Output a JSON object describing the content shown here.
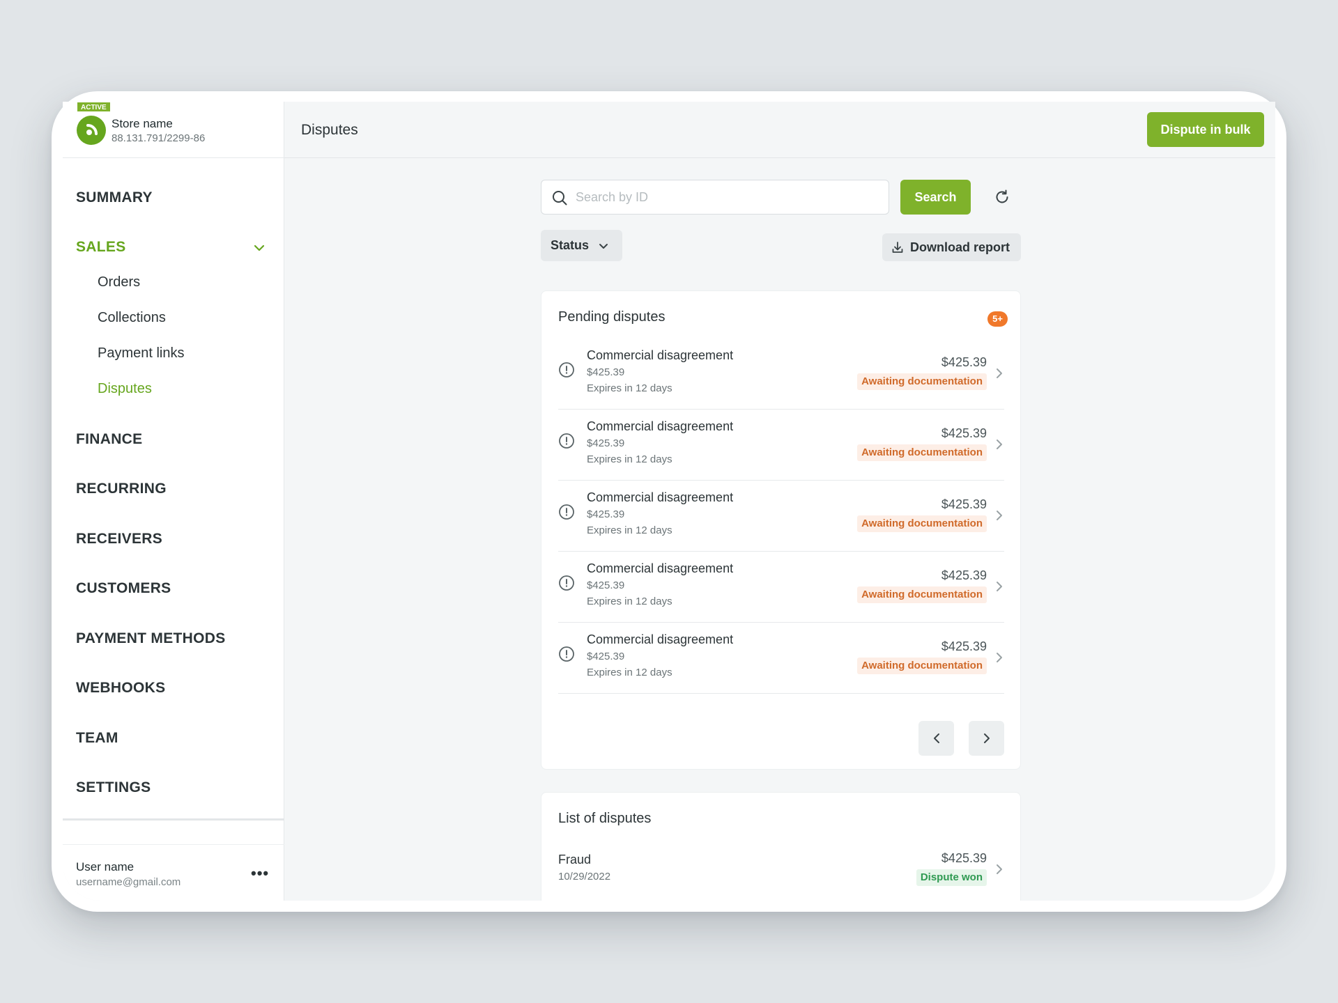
{
  "store": {
    "status_tag": "ACTIVE",
    "name": "Store name",
    "id": "88.131.791/2299-86"
  },
  "nav": {
    "summary": "SUMMARY",
    "sales": "SALES",
    "sales_sub": [
      "Orders",
      "Collections",
      "Payment links",
      "Disputes"
    ],
    "finance": "FINANCE",
    "recurring": "RECURRING",
    "receivers": "RECEIVERS",
    "customers": "CUSTOMERS",
    "payment_methods": "PAYMENT METHODS",
    "webhooks": "WEBHOOKS",
    "team": "TEAM",
    "settings": "SETTINGS"
  },
  "user": {
    "name": "User name",
    "email": "username@gmail.com",
    "more": "•••"
  },
  "header": {
    "title": "Disputes",
    "bulk_button": "Dispute in bulk"
  },
  "search": {
    "placeholder": "Search by ID",
    "button": "Search"
  },
  "filters": {
    "status": "Status",
    "download": "Download report"
  },
  "pending": {
    "title": "Pending disputes",
    "count": "5+",
    "rows": [
      {
        "title": "Commercial disagreement",
        "value": "$425.39",
        "expires": "Expires in 12 days",
        "amount": "$425.39",
        "status": "Awaiting documentation"
      },
      {
        "title": "Commercial disagreement",
        "value": "$425.39",
        "expires": "Expires in 12 days",
        "amount": "$425.39",
        "status": "Awaiting documentation"
      },
      {
        "title": "Commercial disagreement",
        "value": "$425.39",
        "expires": "Expires in 12 days",
        "amount": "$425.39",
        "status": "Awaiting documentation"
      },
      {
        "title": "Commercial disagreement",
        "value": "$425.39",
        "expires": "Expires in 12 days",
        "amount": "$425.39",
        "status": "Awaiting documentation"
      },
      {
        "title": "Commercial disagreement",
        "value": "$425.39",
        "expires": "Expires in 12 days",
        "amount": "$425.39",
        "status": "Awaiting documentation"
      }
    ]
  },
  "list": {
    "title": "List of disputes",
    "rows": [
      {
        "title": "Fraud",
        "date": "10/29/2022",
        "amount": "$425.39",
        "status": "Dispute won"
      }
    ]
  },
  "colors": {
    "brand_green": "#7fb22b",
    "nav_active_green": "#66a61e",
    "count_badge_orange": "#f0782a",
    "awaiting_text": "#d06a2a",
    "won_text": "#2f9a52"
  }
}
